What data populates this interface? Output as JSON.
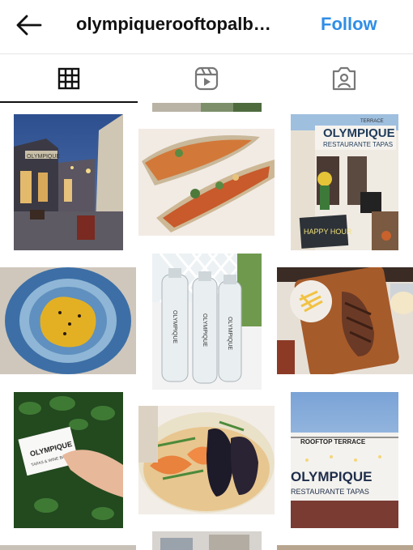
{
  "header": {
    "account_name": "olympiquerooftopalb…",
    "follow_label": "Follow"
  },
  "tabs": [
    {
      "name": "grid",
      "icon": "grid-icon",
      "selected": true
    },
    {
      "name": "reels",
      "icon": "reels-icon",
      "selected": false
    },
    {
      "name": "tagged",
      "icon": "tagged-icon",
      "selected": false
    }
  ],
  "posts": [
    {
      "subject": "street-night",
      "sign_text": "OLYMPIQUE"
    },
    {
      "subject": "razor-clams"
    },
    {
      "subject": "restaurant-front",
      "sign_main": "OLYMPIQUE",
      "sign_sub": "RESTAURANTE TAPAS",
      "sign_top": "TERRACE",
      "chalkboard": "HAPPY HOUR"
    },
    {
      "subject": "ravioli-plate"
    },
    {
      "subject": "water-bottles",
      "bottle_label": "OLYMPIQUE"
    },
    {
      "subject": "steak-fries"
    },
    {
      "subject": "business-card",
      "card_title": "OLYMPIQUE",
      "card_line": "TAPAS & WINE BAR"
    },
    {
      "subject": "mussels-risotto"
    },
    {
      "subject": "rooftop-sign",
      "sign_top": "ROOFTOP TERRACE",
      "sign_main": "OLYMPIQUE",
      "sign_sub": "RESTAURANTE TAPAS"
    }
  ],
  "colors": {
    "accent": "#2f8ee6",
    "text": "#111111",
    "divider": "#e6e6e6"
  }
}
